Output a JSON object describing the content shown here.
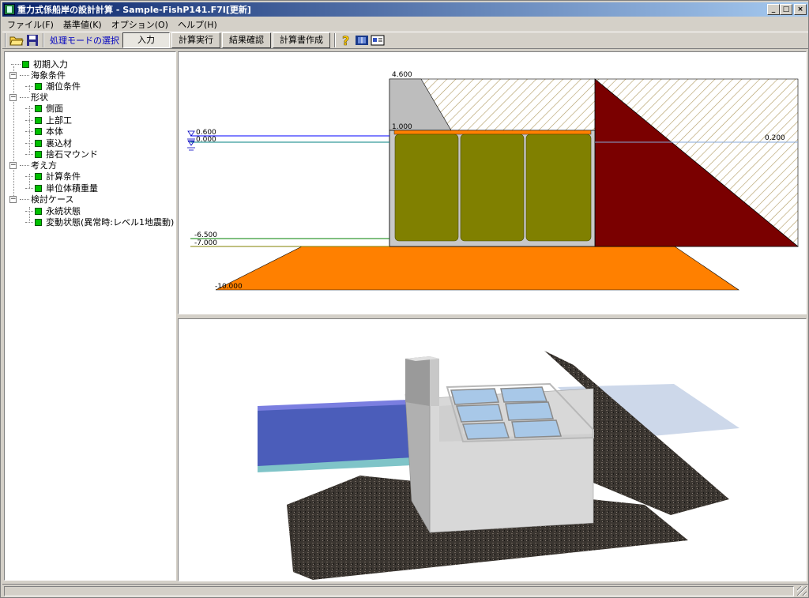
{
  "window": {
    "title": "重力式係船岸の設計計算 - Sample-FishP141.F7I[更新]",
    "minimize_label": "_",
    "maximize_label": "□",
    "close_label": "×"
  },
  "menu": [
    "ファイル(F)",
    "基準値(K)",
    "オプション(O)",
    "ヘルプ(H)"
  ],
  "toolbar": {
    "mode_label": "処理モードの選択",
    "mode_buttons": [
      "入力",
      "計算実行",
      "結果確認",
      "計算書作成"
    ],
    "active_mode": "入力",
    "icons": [
      "open-folder-icon",
      "save-icon",
      "help-icon",
      "book-icon",
      "card-icon"
    ]
  },
  "tree": {
    "root": "初期入力",
    "groups": [
      {
        "label": "海象条件",
        "children": [
          "潮位条件"
        ]
      },
      {
        "label": "形状",
        "children": [
          "側面",
          "上部工",
          "本体",
          "裏込材",
          "捨石マウンド"
        ]
      },
      {
        "label": "考え方",
        "children": [
          "計算条件",
          "単位体積重量"
        ]
      },
      {
        "label": "検討ケース",
        "children": [
          "永続状態",
          "変動状態(異常時:レベル1地震動)"
        ]
      }
    ]
  },
  "section_view": {
    "labels": {
      "top_elev": "4.600",
      "hwl": "0.600",
      "lwl": "0.000",
      "caisson_top": "1.000",
      "rwl": "0.200",
      "seabed": "-6.500",
      "caisson_bottom": "-7.000",
      "mound_bottom": "-10.000"
    },
    "colors": {
      "caisson_fill": "#808000",
      "backfill": "#800000",
      "mound": "#ff8000",
      "crown": "#c0c0c0",
      "water_line": "#0000ff"
    }
  },
  "model_view": {
    "colors": {
      "sea": "#3c4fb4",
      "caisson": "#d8d8d8",
      "rubble": "#3a3530",
      "ground_water": "#c8d4e8"
    }
  }
}
